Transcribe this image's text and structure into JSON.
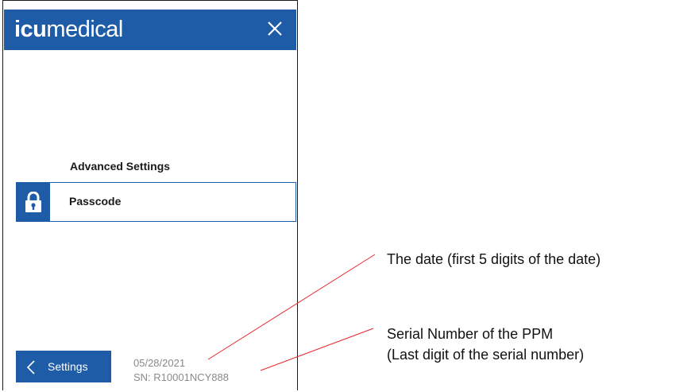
{
  "header": {
    "logo_bold": "icu",
    "logo_light": "medical",
    "brand_color": "#1f5ca8",
    "close_icon": "close-icon"
  },
  "main": {
    "section_title": "Advanced Settings",
    "items": [
      {
        "label": "Passcode",
        "icon": "lock-icon"
      }
    ]
  },
  "footer": {
    "back_label": "Settings",
    "back_icon": "chevron-left-icon",
    "date": "05/28/2021",
    "serial": "SN: R10001NCY888"
  },
  "annotations": {
    "date": "The date (first 5 digits of the date)",
    "serial_line1": "Serial Number of the PPM",
    "serial_line2": "(Last digit of the serial number)",
    "line_color": "#e8262c"
  }
}
